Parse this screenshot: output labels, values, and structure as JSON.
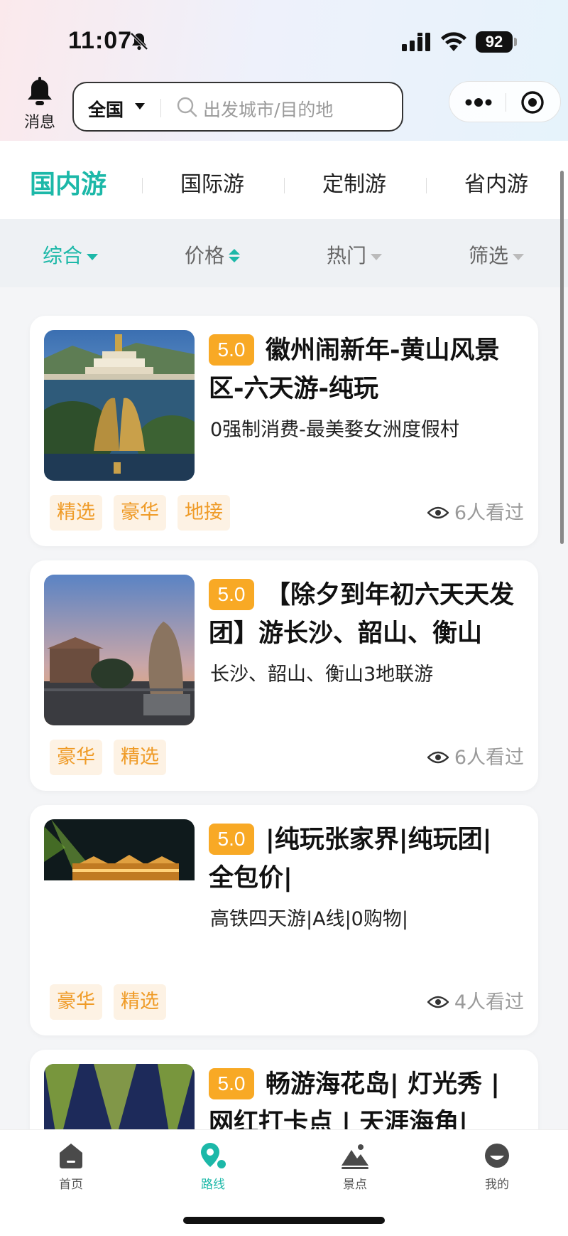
{
  "status": {
    "time": "11:07",
    "battery": "92"
  },
  "header": {
    "messages_label": "消息",
    "region": "全国",
    "search_placeholder": "出发城市/目的地"
  },
  "tabs": [
    {
      "label": "国内游"
    },
    {
      "label": "国际游"
    },
    {
      "label": "定制游"
    },
    {
      "label": "省内游"
    }
  ],
  "filters": [
    {
      "label": "综合"
    },
    {
      "label": "价格"
    },
    {
      "label": "热门"
    },
    {
      "label": "筛选"
    }
  ],
  "cards": [
    {
      "rating": "5.0",
      "title": "徽州闹新年-黄山风景区-六天游-纯玩",
      "subtitle": "0强制消费-最美婺女洲度假村",
      "tags": [
        "精选",
        "豪华",
        "地接"
      ],
      "views": "6人看过"
    },
    {
      "rating": "5.0",
      "title": "【除夕到年初六天天发团】游长沙、韶山、衡山",
      "subtitle": "长沙、韶山、衡山3地联游",
      "tags": [
        "豪华",
        "精选"
      ],
      "views": "6人看过"
    },
    {
      "rating": "5.0",
      "title": "|纯玩张家界|纯玩团|全包价|",
      "subtitle": "高铁四天游|A线|0购物|",
      "tags": [
        "豪华",
        "精选"
      ],
      "views": "4人看过"
    },
    {
      "rating": "5.0",
      "title": "畅游海花岛| 灯光秀 | 网红打卡点 | 天涯海角|"
    }
  ],
  "bottom_nav": [
    {
      "label": "首页"
    },
    {
      "label": "路线"
    },
    {
      "label": "景点"
    },
    {
      "label": "我的"
    }
  ],
  "colors": {
    "accent": "#1cb8a8",
    "rating_bg": "#f8a925",
    "tag_bg": "#fdf2e4",
    "tag_text": "#ef9b27"
  }
}
